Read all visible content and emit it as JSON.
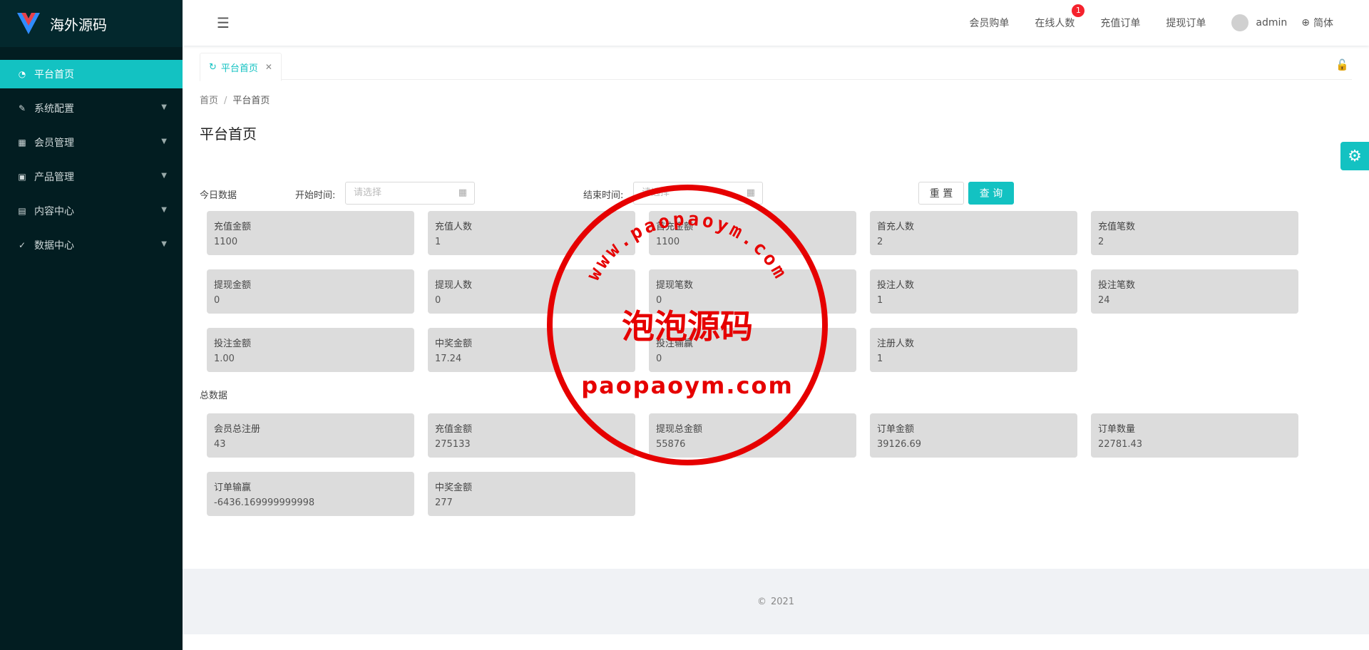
{
  "app": {
    "logo_text": "海外源码"
  },
  "sidebar": {
    "items": [
      {
        "label": "平台首页",
        "icon": "dashboard-icon",
        "active": true
      },
      {
        "label": "系统配置",
        "icon": "edit-icon"
      },
      {
        "label": "会员管理",
        "icon": "table-icon"
      },
      {
        "label": "产品管理",
        "icon": "grid-icon"
      },
      {
        "label": "内容中心",
        "icon": "profile-icon"
      },
      {
        "label": "数据中心",
        "icon": "check-circle-icon"
      }
    ]
  },
  "header": {
    "links": [
      "会员购单",
      "在线人数",
      "充值订单",
      "提现订单"
    ],
    "online_badge": "1",
    "username": "admin",
    "language": "简体"
  },
  "tabs": [
    {
      "label": "平台首页"
    }
  ],
  "breadcrumb": {
    "home": "首页",
    "sep": "/",
    "current": "平台首页"
  },
  "page_title": "平台首页",
  "filter": {
    "section_label": "今日数据",
    "start_label": "开始时间:",
    "end_label": "结束时间:",
    "start_placeholder": "请选择",
    "end_placeholder": "请选择",
    "reset": "重 置",
    "query": "查 询"
  },
  "today": [
    {
      "label": "充值金额",
      "value": "1100"
    },
    {
      "label": "充值人数",
      "value": "1"
    },
    {
      "label": "首充金额",
      "value": "1100"
    },
    {
      "label": "首充人数",
      "value": "2"
    },
    {
      "label": "充值笔数",
      "value": "2"
    },
    {
      "label": "提现金额",
      "value": "0"
    },
    {
      "label": "提现人数",
      "value": "0"
    },
    {
      "label": "提现笔数",
      "value": "0"
    },
    {
      "label": "投注人数",
      "value": "1"
    },
    {
      "label": "投注笔数",
      "value": "24"
    },
    {
      "label": "投注金额",
      "value": "1.00"
    },
    {
      "label": "中奖金额",
      "value": "17.24"
    },
    {
      "label": "投注输赢",
      "value": "0"
    },
    {
      "label": "注册人数",
      "value": "1"
    }
  ],
  "total_label": "总数据",
  "total": [
    {
      "label": "会员总注册",
      "value": "43"
    },
    {
      "label": "充值金额",
      "value": "275133"
    },
    {
      "label": "提现总金额",
      "value": "55876"
    },
    {
      "label": "订单金额",
      "value": "39126.69"
    },
    {
      "label": "订单数量",
      "value": "22781.43"
    },
    {
      "label": "订单输赢",
      "value": "-6436.169999999998"
    },
    {
      "label": "中奖金额",
      "value": "277"
    }
  ],
  "footer": {
    "copyright": "©",
    "year": "2021"
  },
  "watermark": {
    "top_text": "www.paopaoym.com",
    "center_text": "泡泡源码",
    "bottom_text": "paopaoym.com"
  },
  "colors": {
    "accent": "#13c2c2",
    "sidebar": "#021d21",
    "stamp": "#e60000"
  }
}
